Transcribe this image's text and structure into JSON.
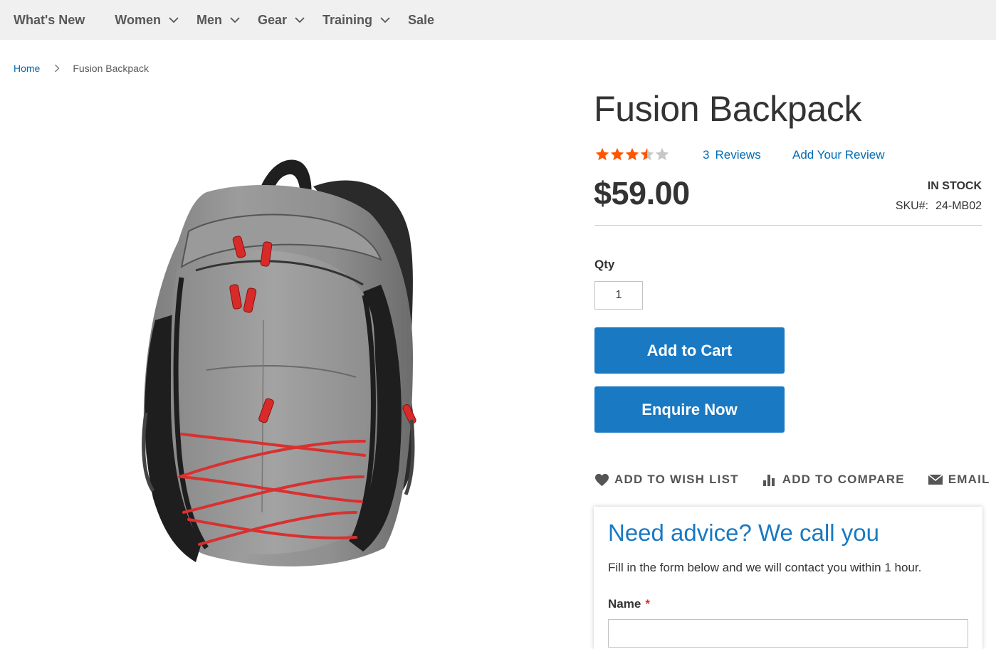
{
  "nav": {
    "items": [
      {
        "label": "What's New",
        "has_dropdown": false
      },
      {
        "label": "Women",
        "has_dropdown": true
      },
      {
        "label": "Men",
        "has_dropdown": true
      },
      {
        "label": "Gear",
        "has_dropdown": true
      },
      {
        "label": "Training",
        "has_dropdown": true
      },
      {
        "label": "Sale",
        "has_dropdown": false
      }
    ]
  },
  "breadcrumb": {
    "home": "Home",
    "current": "Fusion Backpack"
  },
  "product": {
    "title": "Fusion Backpack",
    "rating": {
      "value": 3.5,
      "max": 5,
      "star_color": "#ff5501",
      "empty_color": "#c7c7c7"
    },
    "reviews_count": "3",
    "reviews_label": "Reviews",
    "add_review_label": "Add Your Review",
    "price": "$59.00",
    "stock": "IN STOCK",
    "sku_label": "SKU#:",
    "sku_value": "24-MB02",
    "qty_label": "Qty",
    "qty_value": "1",
    "add_to_cart_label": "Add to Cart",
    "enquire_label": "Enquire Now",
    "image_icon": "backpack-image"
  },
  "actions": {
    "wishlist_label": "ADD TO WISH LIST",
    "compare_label": "ADD TO COMPARE",
    "email_label": "EMAIL"
  },
  "advice": {
    "title": "Need advice? We call you",
    "text": "Fill in the form below and we will contact you within 1 hour.",
    "name_label": "Name",
    "required_mark": "*"
  },
  "colors": {
    "accent": "#1979c3",
    "link": "#006bb4",
    "nav_bg": "#f0f0f0",
    "required": "#e02b27"
  }
}
